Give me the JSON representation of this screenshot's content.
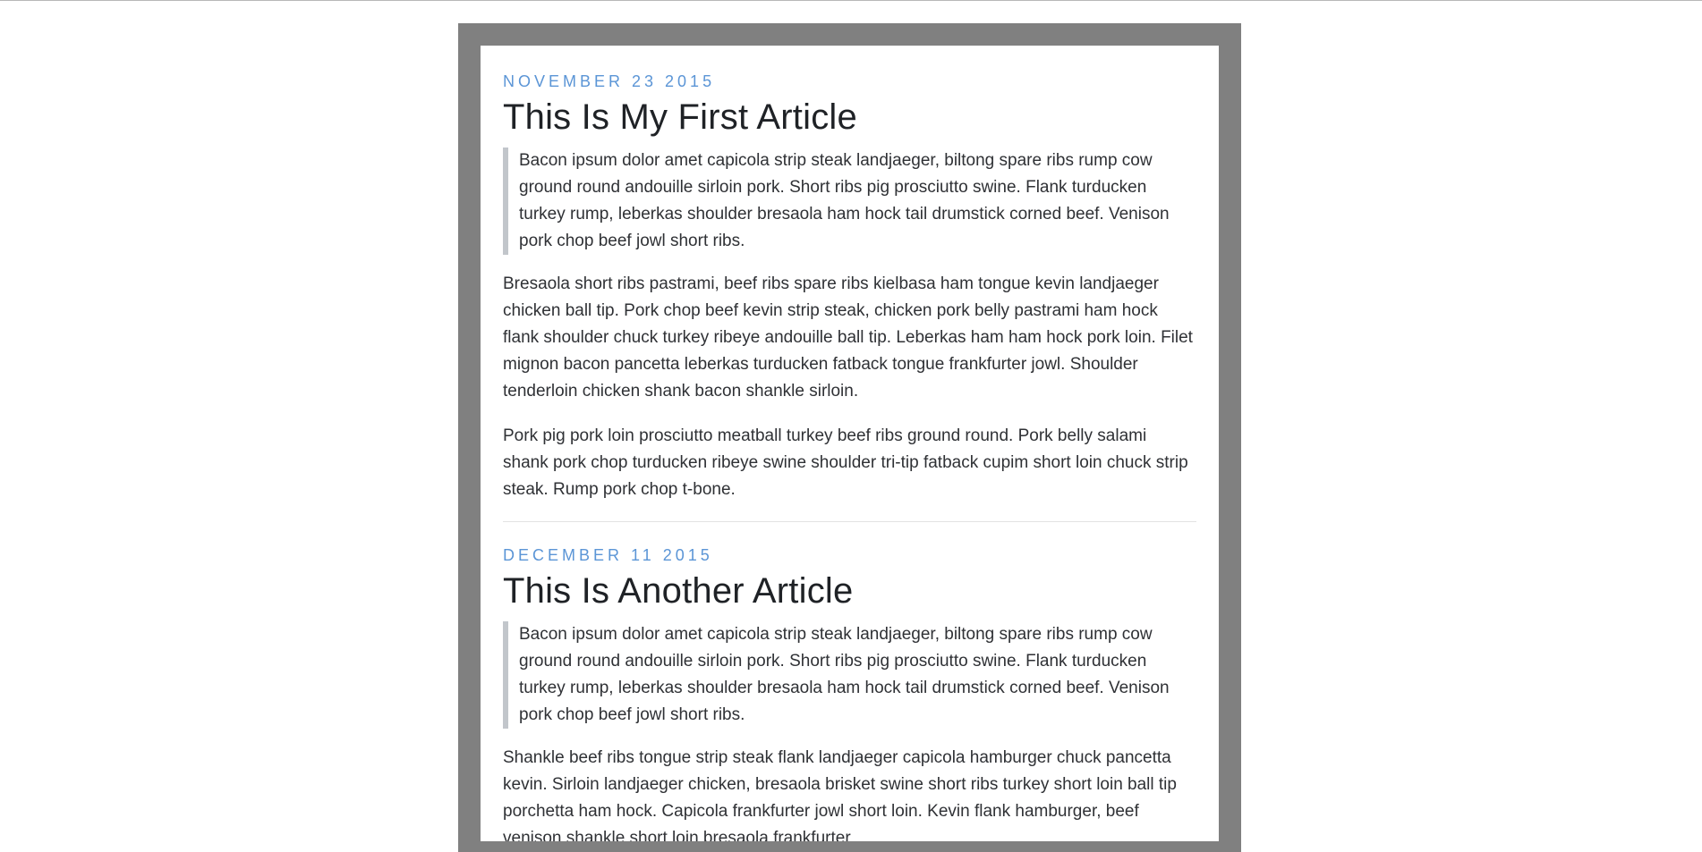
{
  "articles": [
    {
      "date": "NOVEMBER 23 2015",
      "title": "This Is My First Article",
      "quote": "Bacon ipsum dolor amet capicola strip steak landjaeger, biltong spare ribs rump cow ground round andouille sirloin pork. Short ribs pig prosciutto swine. Flank turducken turkey rump, leberkas shoulder bresaola ham hock tail drumstick corned beef. Venison pork chop beef jowl short ribs.",
      "paragraphs": [
        "Bresaola short ribs pastrami, beef ribs spare ribs kielbasa ham tongue kevin landjaeger chicken ball tip. Pork chop beef kevin strip steak, chicken pork belly pastrami ham hock flank shoulder chuck turkey ribeye andouille ball tip. Leberkas ham ham hock pork loin. Filet mignon bacon pancetta leberkas turducken fatback tongue frankfurter jowl. Shoulder tenderloin chicken shank bacon shankle sirloin.",
        "Pork pig pork loin prosciutto meatball turkey beef ribs ground round. Pork belly salami shank pork chop turducken ribeye swine shoulder tri-tip fatback cupim short loin chuck strip steak. Rump pork chop t-bone."
      ]
    },
    {
      "date": "DECEMBER 11 2015",
      "title": "This Is Another Article",
      "quote": "Bacon ipsum dolor amet capicola strip steak landjaeger, biltong spare ribs rump cow ground round andouille sirloin pork. Short ribs pig prosciutto swine. Flank turducken turkey rump, leberkas shoulder bresaola ham hock tail drumstick corned beef. Venison pork chop beef jowl short ribs.",
      "paragraphs": [
        "Shankle beef ribs tongue strip steak flank landjaeger capicola hamburger chuck pancetta kevin. Sirloin landjaeger chicken, bresaola brisket swine short ribs turkey short loin ball tip porchetta ham hock. Capicola frankfurter jowl short loin. Kevin flank hamburger, beef venison shankle short loin bresaola frankfurter"
      ]
    }
  ],
  "colors": {
    "frame": "#808080",
    "date_accent": "#5b95d6",
    "quote_border": "#c2c6cb"
  }
}
